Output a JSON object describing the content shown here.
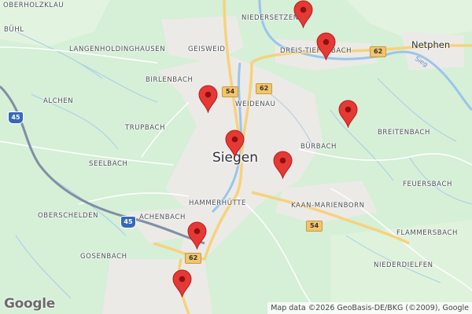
{
  "map": {
    "city": "Siegen",
    "towns": [
      {
        "id": "netphen",
        "label": "Netphen"
      }
    ],
    "places": [
      {
        "id": "oberholzklau",
        "label": "OBERHOLZKLAU"
      },
      {
        "id": "niedersetzen",
        "label": "NIEDERSETZEN"
      },
      {
        "id": "buhl",
        "label": "BÜHL"
      },
      {
        "id": "langenholdinghausen",
        "label": "LANGENHOLDINGHAUSEN"
      },
      {
        "id": "geisweid",
        "label": "GEISWEID"
      },
      {
        "id": "dreis-tiefenbach",
        "label": "DREIS-TIEFENBACH"
      },
      {
        "id": "birlenbach",
        "label": "BIRLENBACH"
      },
      {
        "id": "weidenau",
        "label": "WEIDENAU"
      },
      {
        "id": "alchen",
        "label": "ALCHEN"
      },
      {
        "id": "trupbach",
        "label": "TRUPBACH"
      },
      {
        "id": "breitenbach",
        "label": "BREITENBACH"
      },
      {
        "id": "burbach",
        "label": "BÜRBACH"
      },
      {
        "id": "seelbach",
        "label": "SEELBACH"
      },
      {
        "id": "feuersbach",
        "label": "FEUERSBACH"
      },
      {
        "id": "hammerhutte",
        "label": "HAMMERHÜTTE"
      },
      {
        "id": "kaan-marienborn",
        "label": "KAAN-MARIENBORN"
      },
      {
        "id": "oberschelden",
        "label": "OBERSCHELDEN"
      },
      {
        "id": "achenbach",
        "label": "ACHENBACH"
      },
      {
        "id": "flammersbach",
        "label": "FLAMMERSBACH"
      },
      {
        "id": "gosenbach",
        "label": "GOSENBACH"
      },
      {
        "id": "niederdielfen",
        "label": "NIEDERDIELFEN"
      }
    ],
    "river_label": "Sieg",
    "road_shields": [
      {
        "id": "b62-north",
        "label": "62",
        "type": "federal"
      },
      {
        "id": "b62-weidenau",
        "label": "62",
        "type": "federal"
      },
      {
        "id": "b54-weidenau",
        "label": "54",
        "type": "federal"
      },
      {
        "id": "b54-kaan",
        "label": "54",
        "type": "federal"
      },
      {
        "id": "b62-south",
        "label": "62",
        "type": "federal"
      },
      {
        "id": "a45-west",
        "label": "45",
        "type": "autobahn"
      },
      {
        "id": "a45-achenbach",
        "label": "45",
        "type": "autobahn"
      }
    ],
    "markers": [
      {
        "id": "marker-niedersetzen",
        "color": "#e53935"
      },
      {
        "id": "marker-dreis-tiefenbach",
        "color": "#e53935"
      },
      {
        "id": "marker-birlenbach",
        "color": "#e53935"
      },
      {
        "id": "marker-breitenbach",
        "color": "#e53935"
      },
      {
        "id": "marker-siegen-center",
        "color": "#e53935"
      },
      {
        "id": "marker-burbach",
        "color": "#e53935"
      },
      {
        "id": "marker-achenbach",
        "color": "#e53935"
      },
      {
        "id": "marker-gosenbach",
        "color": "#e53935"
      }
    ],
    "logo": "Google",
    "attribution": "Map data ©2026 GeoBasis-DE/BKG (©2009), Google",
    "colors": {
      "land": "#d6efd7",
      "urban": "#eceae6",
      "water": "#9ac5ec",
      "marker": "#e53935",
      "road_major": "#f6d27e"
    }
  }
}
